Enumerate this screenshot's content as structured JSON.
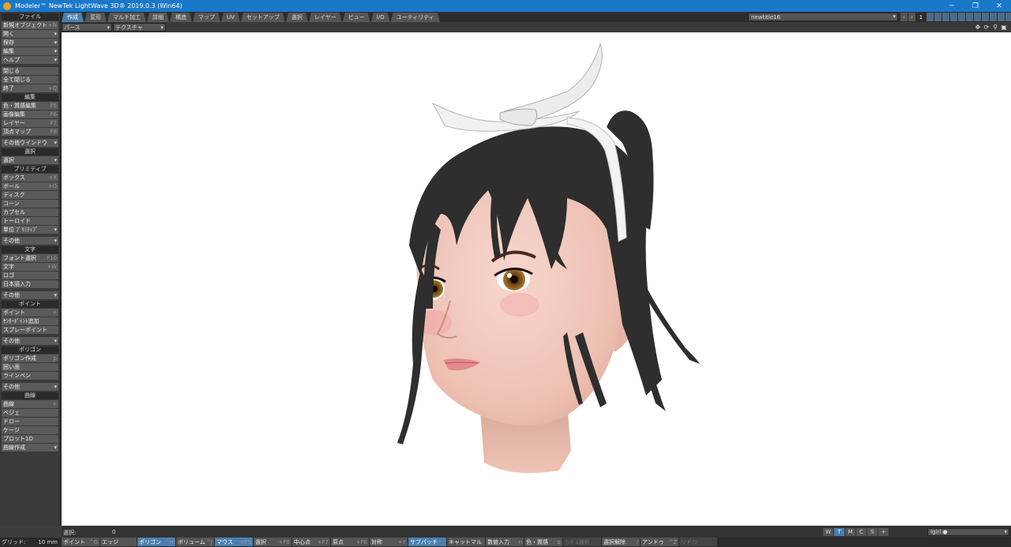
{
  "app": {
    "title": "Modeler™ NewTek LightWave 3D® 2019.0.3 (Win64)"
  },
  "window_controls": {
    "minimize": "─",
    "restore": "❐",
    "close": "✕"
  },
  "tabs": [
    "作成",
    "変形",
    "マルチ加工",
    "詳細",
    "構造",
    "マップ",
    "UV",
    "セットアップ",
    "選択",
    "レイヤー",
    "ビュー",
    "I/O",
    "ユーティリティ"
  ],
  "active_tab": "作成",
  "scene": {
    "name": "newtitle16",
    "layer_number": "1"
  },
  "view": {
    "projection": "パース",
    "render_mode": "テクスチャ"
  },
  "sidebar": {
    "sections": [
      {
        "title": "ファイル",
        "items": [
          {
            "label": "新規オブジェクト",
            "shortcut": "+N"
          },
          {
            "label": "開く",
            "dropdown": true
          },
          {
            "label": "保存",
            "dropdown": true
          },
          {
            "label": "編集",
            "dropdown": true
          },
          {
            "label": "ヘルプ",
            "dropdown": true
          },
          {
            "spacer": true
          },
          {
            "label": "閉じる"
          },
          {
            "label": "全て閉じる"
          },
          {
            "label": "終了",
            "shortcut": "+Q"
          }
        ]
      },
      {
        "title": "編集",
        "items": [
          {
            "label": "色・質感編集",
            "shortcut": "F5"
          },
          {
            "label": "画像編集",
            "shortcut": "F6"
          },
          {
            "label": "レイヤー",
            "shortcut": "F7"
          },
          {
            "label": "頂点マップ",
            "shortcut": "F8"
          },
          {
            "spacer": true
          },
          {
            "label": "その他ウインドウ",
            "dropdown": true
          }
        ]
      },
      {
        "title": "選択",
        "items": [
          {
            "label": "選択",
            "dropdown": true
          }
        ]
      },
      {
        "title": "プリミティブ",
        "items": [
          {
            "label": "ボックス",
            "shortcut": "+X"
          },
          {
            "label": "ボール",
            "shortcut": "+O"
          },
          {
            "label": "ディスク"
          },
          {
            "label": "コーン"
          },
          {
            "label": "カプセル"
          },
          {
            "label": "トーロイド"
          },
          {
            "label": "単位 ﾌﾟﾘﾐﾃｨﾌﾞ",
            "dropdown": true
          },
          {
            "spacer": true
          },
          {
            "label": "その他",
            "dropdown": true
          }
        ]
      },
      {
        "title": "文字",
        "items": [
          {
            "label": "フォント選択",
            "shortcut": "F10"
          },
          {
            "label": "文字",
            "shortcut": "+W"
          },
          {
            "label": "ロゴ"
          },
          {
            "label": "日本語入力"
          },
          {
            "spacer": true
          },
          {
            "label": "その他",
            "dropdown": true
          }
        ]
      },
      {
        "title": "ポイント",
        "items": [
          {
            "label": "ポイント",
            "shortcut": "+"
          },
          {
            "label": "ｾﾝﾀｰﾎﾟｲﾝﾄ追加"
          },
          {
            "label": "スプレーポイント"
          },
          {
            "spacer": true
          },
          {
            "label": "その他",
            "dropdown": true
          }
        ]
      },
      {
        "title": "ポリゴン",
        "items": [
          {
            "label": "ポリゴン作成",
            "shortcut": "p"
          },
          {
            "label": "囲い面"
          },
          {
            "label": "ラインペン"
          },
          {
            "spacer": true
          },
          {
            "label": "その他",
            "dropdown": true
          }
        ]
      },
      {
        "title": "曲線",
        "items": [
          {
            "label": "曲線",
            "shortcut": "+"
          },
          {
            "label": "ベジェ"
          },
          {
            "label": "ドロー"
          },
          {
            "label": "ケージ"
          },
          {
            "label": "プロット1D"
          },
          {
            "label": "曲線作成",
            "dropdown": true
          }
        ]
      }
    ]
  },
  "info": {
    "selection_label": "選択:",
    "selection_count": "0"
  },
  "view_buttons": [
    "W",
    "T",
    "M",
    "C",
    "S",
    "+"
  ],
  "view_buttons_active": "T",
  "object": {
    "name": "Igirl ●"
  },
  "bottom": {
    "grid_label": "グリッド:",
    "grid_value": "10 mm",
    "buttons": [
      {
        "label": "ポイント",
        "shortcut": "^G",
        "w": 48
      },
      {
        "label": "エッジ",
        "w": 46
      },
      {
        "label": "ポリゴン",
        "shortcut": "^H",
        "w": 48,
        "active": true
      },
      {
        "label": "ボリューム",
        "shortcut": "^J",
        "w": 48
      },
      {
        "label": "マウス",
        "shortcut": "+F5",
        "w": 48,
        "active": true
      },
      {
        "label": "選択",
        "shortcut": "+F8",
        "w": 48
      },
      {
        "label": "中心点",
        "shortcut": "+F7",
        "w": 48
      },
      {
        "label": "原点",
        "shortcut": "+F6",
        "w": 48
      },
      {
        "label": "対称",
        "shortcut": "+Y",
        "w": 48
      },
      {
        "label": "サブパッチ",
        "w": 48,
        "active": true
      },
      {
        "label": "キャットマル",
        "w": 48
      },
      {
        "label": "数値入力",
        "shortcut": "n",
        "w": 48
      },
      {
        "label": "色・質感",
        "shortcut": "q",
        "w": 48
      },
      {
        "label": "ﾗﾝﾀﾞﾑ選択",
        "w": 48,
        "dim": true
      },
      {
        "label": "選択解除",
        "shortcut": "/",
        "w": 48
      },
      {
        "label": "アンドゥ",
        "shortcut": "^Z",
        "w": 48
      },
      {
        "label": "リドゥ",
        "w": 48,
        "dim": true
      }
    ]
  },
  "colors": {
    "accent": "#4a7fb0",
    "titlebar": "#1a78c8",
    "panel": "#3a3a3a",
    "viewport_bg": "#ffffff"
  }
}
